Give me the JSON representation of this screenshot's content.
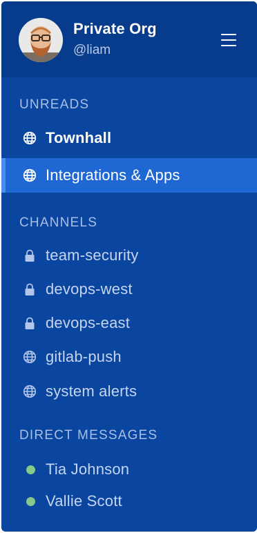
{
  "header": {
    "org_name": "Private Org",
    "username": "@liam"
  },
  "sections": {
    "unreads": {
      "label": "UNREADS",
      "items": [
        {
          "label": "Townhall",
          "icon": "globe-icon",
          "state": "unread"
        },
        {
          "label": "Integrations & Apps",
          "icon": "globe-icon",
          "state": "active"
        }
      ]
    },
    "channels": {
      "label": "CHANNELS",
      "items": [
        {
          "label": "team-security",
          "icon": "lock-icon"
        },
        {
          "label": "devops-west",
          "icon": "lock-icon"
        },
        {
          "label": "devops-east",
          "icon": "lock-icon"
        },
        {
          "label": "gitlab-push",
          "icon": "globe-icon"
        },
        {
          "label": "system alerts",
          "icon": "globe-icon"
        }
      ]
    },
    "direct_messages": {
      "label": "DIRECT MESSAGES",
      "items": [
        {
          "label": "Tia Johnson",
          "status": "online"
        },
        {
          "label": "Vallie Scott",
          "status": "online"
        }
      ]
    }
  },
  "colors": {
    "sidebar_bg": "#0a46a0",
    "header_bg": "#073c8c",
    "active_bg": "#1f68d3",
    "online_status": "#86c98a"
  }
}
